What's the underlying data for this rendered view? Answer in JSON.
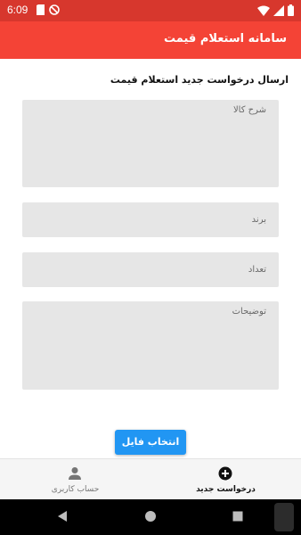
{
  "status_bar": {
    "time": "6:09"
  },
  "app_bar": {
    "title": "سامانه استعلام قیمت"
  },
  "form": {
    "section_title": "ارسال درخواست جدید استعلام قیمت",
    "description_placeholder": "شرح کالا",
    "brand_placeholder": "برند",
    "quantity_placeholder": "تعداد",
    "notes_placeholder": "توضیحات",
    "file_button": "انتخاب فایل"
  },
  "bottom_nav": {
    "items": [
      {
        "label": "درخواست جدید",
        "icon": "add-circle-icon",
        "active": true
      },
      {
        "label": "حساب کاربری",
        "icon": "person-icon",
        "active": false
      }
    ]
  },
  "colors": {
    "status_bar": "#d7372d",
    "app_bar": "#f44336",
    "button": "#2196f3"
  }
}
